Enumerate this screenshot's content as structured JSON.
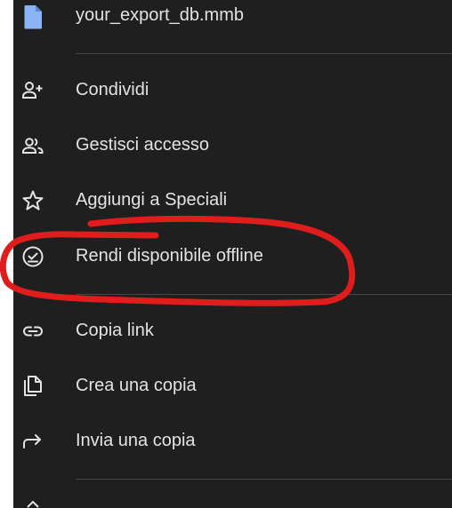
{
  "file": {
    "name": "your_export_db.mmb",
    "icon": "document-icon",
    "icon_color": "#8ab4f8"
  },
  "menu": {
    "items": [
      {
        "label": "Condividi",
        "icon": "person-add-icon"
      },
      {
        "label": "Gestisci accesso",
        "icon": "people-icon"
      },
      {
        "label": "Aggiungi a Speciali",
        "icon": "star-icon"
      },
      {
        "label": "Rendi disponibile offline",
        "icon": "offline-check-icon"
      },
      {
        "label": "Copia link",
        "icon": "link-icon"
      },
      {
        "label": "Crea una copia",
        "icon": "copy-icon"
      },
      {
        "label": "Invia una copia",
        "icon": "share-arrow-icon"
      }
    ]
  },
  "colors": {
    "sheet_background": "#1f1f1f",
    "text": "#e3e3e3",
    "annotation": "#e01d1d"
  }
}
